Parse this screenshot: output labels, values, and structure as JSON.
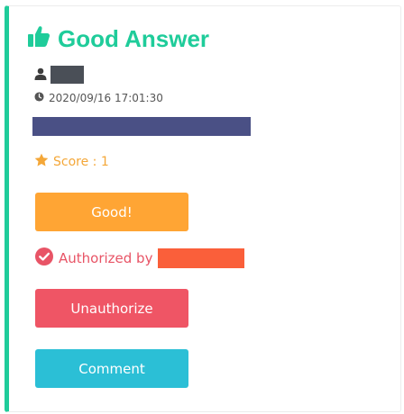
{
  "colors": {
    "accent": "#1fcc9a",
    "good_button": "#ffa534",
    "unauthorize_button": "#ef5565",
    "comment_button": "#2bbfd6",
    "authorized_text": "#e85466",
    "score_text": "#f4a738",
    "redaction_user": "#4a4f57",
    "redaction_content": "#4a5085",
    "redaction_authorizer": "#fa5f3a"
  },
  "card": {
    "title": "Good Answer",
    "title_icon": "thumbs-up-icon",
    "user_icon": "user-icon",
    "date_icon": "clock-icon",
    "timestamp": "2020/09/16 17:01:30",
    "score_icon": "star-icon",
    "score_text": "Score : 1",
    "good_label": "Good!",
    "authorized_icon": "check-circle-icon",
    "authorized_text": "Authorized by",
    "unauthorize_label": "Unauthorize",
    "comment_label": "Comment"
  }
}
